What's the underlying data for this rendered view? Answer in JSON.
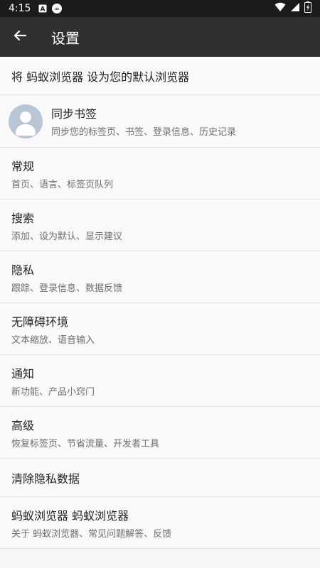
{
  "status_bar": {
    "time": "4:15",
    "left_icons": [
      "text-a-icon",
      "infinity-icon"
    ],
    "right_icons": [
      "wifi-icon",
      "signal-icon",
      "battery-icon"
    ]
  },
  "app_bar": {
    "back_icon": "arrow-left-icon",
    "title": "设置"
  },
  "settings": {
    "default_browser": {
      "label": "将 蚂蚁浏览器 设为您的默认浏览器"
    },
    "sync": {
      "label": "同步书签",
      "sub": "同步您的标签页、书签、登录信息、历史记录",
      "avatar_icon": "user-avatar-icon"
    },
    "general": {
      "label": "常规",
      "sub": "首页、语言、标签页队列"
    },
    "search": {
      "label": "搜索",
      "sub": "添加、设为默认、显示建议"
    },
    "privacy": {
      "label": "隐私",
      "sub": "跟踪、登录信息、数据反馈"
    },
    "accessibility": {
      "label": "无障碍环境",
      "sub": "文本缩放、语音输入"
    },
    "notifications": {
      "label": "通知",
      "sub": "新功能、产品小窍门"
    },
    "advanced": {
      "label": "高级",
      "sub": "恢复标签页、节省流量、开发者工具"
    },
    "clear_data": {
      "label": "清除隐私数据"
    },
    "about": {
      "label": "蚂蚁浏览器 蚂蚁浏览器",
      "sub": "关于 蚂蚁浏览器、常见问题解答、反馈"
    }
  },
  "colors": {
    "status_bar_bg": "#1b1b1b",
    "app_bar_bg": "#303030",
    "list_bg": "#f9f9f9",
    "divider": "#e2e2e2",
    "primary_text": "#222222",
    "secondary_text": "#6d6d6d",
    "avatar_bg": "#b7c5d4"
  }
}
